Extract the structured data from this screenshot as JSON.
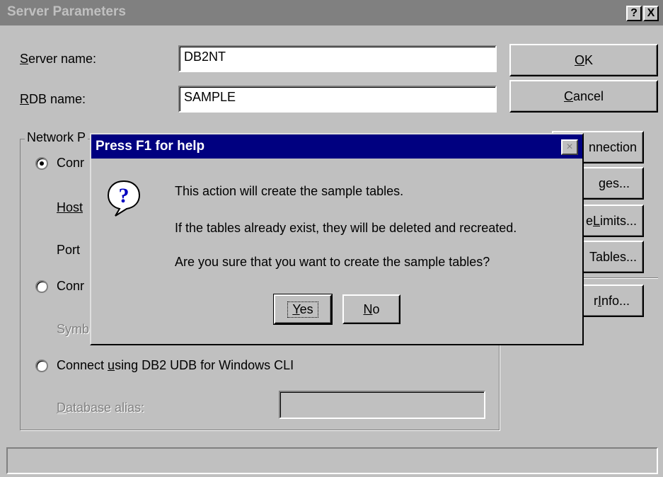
{
  "window": {
    "title": "Server Parameters",
    "help_button": "?",
    "close_button": "X"
  },
  "form": {
    "server_name_label_prefix": "S",
    "server_name_label_rest": "erver name:",
    "server_name_value": "DB2NT",
    "rdb_name_label_prefix": "R",
    "rdb_name_label_rest": "DB name:",
    "rdb_name_value": "SAMPLE"
  },
  "buttons": {
    "ok_prefix": "O",
    "ok_rest": "K",
    "cancel_prefix": "C",
    "cancel_rest": "ancel",
    "connection": "nnection",
    "ges": "ges...",
    "limits_prefix": "e ",
    "limits_u": "L",
    "limits_rest": "imits...",
    "tables": "Tables...",
    "info_prefix": "r ",
    "info_u": "I",
    "info_rest": "nfo..."
  },
  "network_group": {
    "legend": "Network P",
    "option1_partial": "Conr",
    "host_label": "Host",
    "port_label": "Port",
    "option2_partial": "Conr",
    "symb_label": "Symb",
    "option3_label_pre": "Connect ",
    "option3_label_u": "u",
    "option3_label_post": "sing DB2 UDB for Windows CLI",
    "alias_label_u": "D",
    "alias_label_rest": "atabase alias:",
    "alias_value": ""
  },
  "dialog": {
    "title": "Press F1 for help",
    "close": "×",
    "icon": "question-icon",
    "line1": "This action will create the sample tables.",
    "line2": "If the tables already exist, they will be deleted and recreated.",
    "line3": "Are you sure that you want to create the sample tables?",
    "yes_u": "Y",
    "yes_rest": "es",
    "no_u": "N",
    "no_rest": "o"
  },
  "status_bar": {
    "text": ""
  }
}
